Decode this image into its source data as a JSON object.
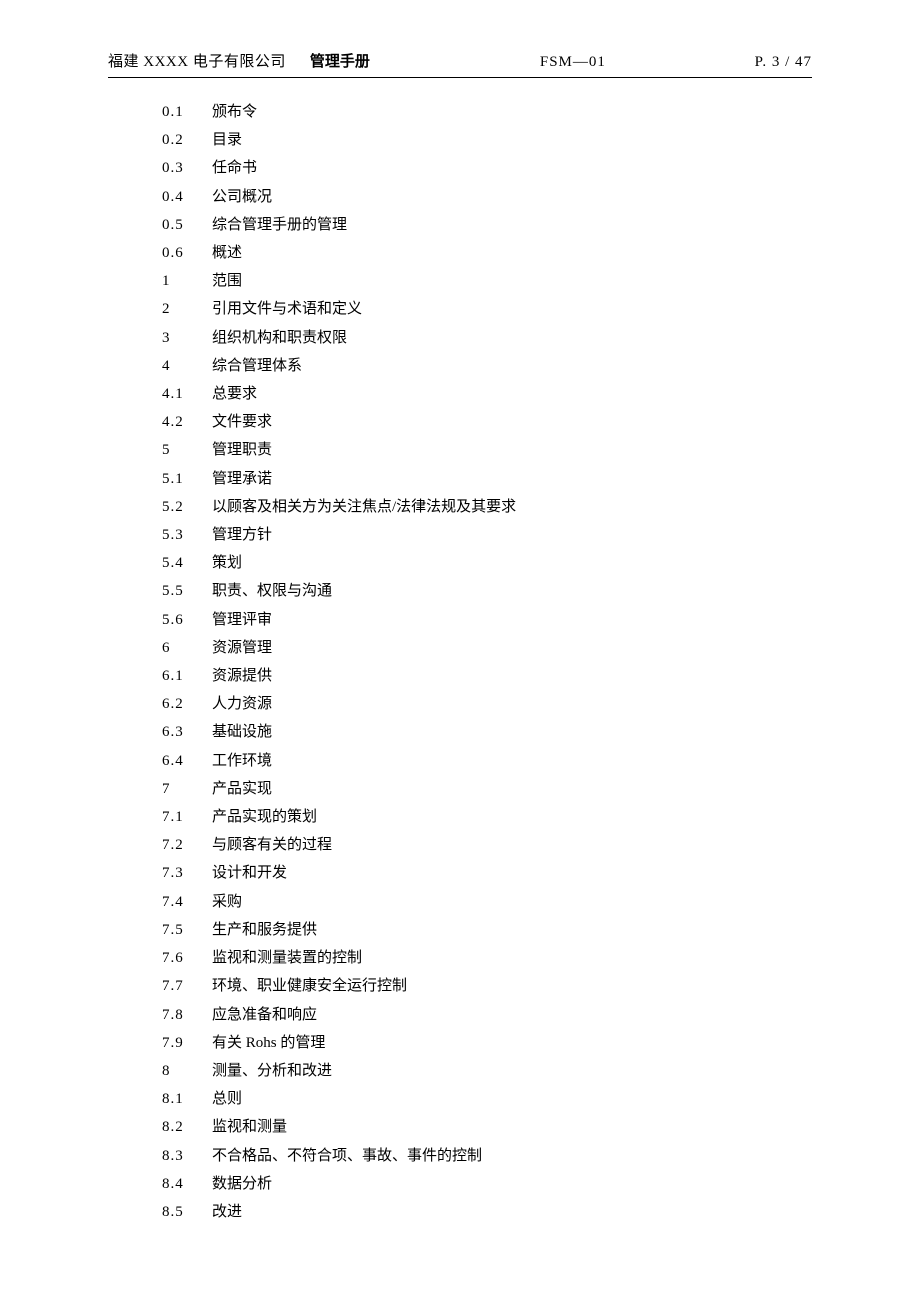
{
  "header": {
    "company": "福建 XXXX 电子有限公司",
    "title": "管理手册",
    "docno": "FSM—01",
    "pagenum": "P. 3 / 47"
  },
  "toc": [
    {
      "num": "0.1",
      "text": "颁布令"
    },
    {
      "num": "0.2",
      "text": "目录"
    },
    {
      "num": "0.3",
      "text": "任命书"
    },
    {
      "num": "0.4",
      "text": "公司概况"
    },
    {
      "num": "0.5",
      "text": "综合管理手册的管理"
    },
    {
      "num": "0.6",
      "text": "概述"
    },
    {
      "num": "1",
      "text": "范围"
    },
    {
      "num": "2",
      "text": "引用文件与术语和定义"
    },
    {
      "num": "3",
      "text": "组织机构和职责权限"
    },
    {
      "num": "4",
      "text": "综合管理体系"
    },
    {
      "num": "4.1",
      "text": "总要求"
    },
    {
      "num": "4.2",
      "text": "文件要求"
    },
    {
      "num": "5",
      "text": "管理职责"
    },
    {
      "num": "5.1",
      "text": "管理承诺"
    },
    {
      "num": "5.2",
      "text": "以顾客及相关方为关注焦点/法律法规及其要求"
    },
    {
      "num": "5.3",
      "text": "管理方针"
    },
    {
      "num": "5.4",
      "text": "策划"
    },
    {
      "num": "5.5",
      "text": "职责、权限与沟通"
    },
    {
      "num": "5.6",
      "text": "管理评审"
    },
    {
      "num": "6",
      "text": "资源管理"
    },
    {
      "num": "6.1",
      "text": "资源提供"
    },
    {
      "num": "6.2",
      "text": "人力资源"
    },
    {
      "num": "6.3",
      "text": "基础设施"
    },
    {
      "num": "6.4",
      "text": "工作环境"
    },
    {
      "num": "7",
      "text": "产品实现"
    },
    {
      "num": "7.1",
      "text": "产品实现的策划"
    },
    {
      "num": "7.2",
      "text": "与顾客有关的过程"
    },
    {
      "num": "7.3",
      "text": "设计和开发"
    },
    {
      "num": "7.4",
      "text": "采购"
    },
    {
      "num": "7.5",
      "text": "生产和服务提供"
    },
    {
      "num": "7.6",
      "text": "监视和测量装置的控制"
    },
    {
      "num": "7.7",
      "text": "环境、职业健康安全运行控制"
    },
    {
      "num": "7.8",
      "text": "应急准备和响应"
    },
    {
      "num": "7.9",
      "text": " 有关 Rohs 的管理"
    },
    {
      "num": "8",
      "text": " 测量、分析和改进"
    },
    {
      "num": "8.1",
      "text": "总则"
    },
    {
      "num": "8.2",
      "text": "监视和测量"
    },
    {
      "num": "8.3",
      "text": "不合格品、不符合项、事故、事件的控制"
    },
    {
      "num": "8.4",
      "text": "数据分析"
    },
    {
      "num": "8.5",
      "text": "改进"
    }
  ]
}
